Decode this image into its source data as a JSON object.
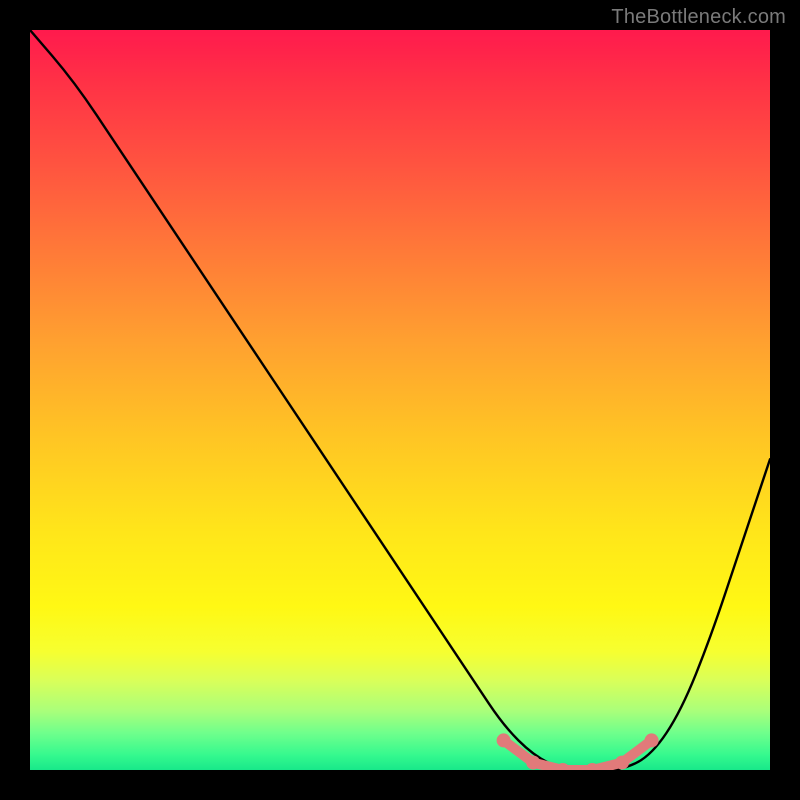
{
  "attribution": "TheBottleneck.com",
  "chart_data": {
    "type": "line",
    "title": "",
    "xlabel": "",
    "ylabel": "",
    "xlim": [
      0,
      100
    ],
    "ylim": [
      0,
      100
    ],
    "x": [
      0,
      6,
      12,
      18,
      24,
      30,
      36,
      42,
      48,
      54,
      60,
      64,
      68,
      72,
      76,
      80,
      84,
      88,
      92,
      96,
      100
    ],
    "y": [
      100,
      93,
      84,
      75,
      66,
      57,
      48,
      39,
      30,
      21,
      12,
      6,
      2,
      0,
      0,
      0,
      2,
      8,
      18,
      30,
      42
    ],
    "series": [
      {
        "name": "bottleneck-curve",
        "x": [
          0,
          6,
          12,
          18,
          24,
          30,
          36,
          42,
          48,
          54,
          60,
          64,
          68,
          72,
          76,
          80,
          84,
          88,
          92,
          96,
          100
        ],
        "y": [
          100,
          93,
          84,
          75,
          66,
          57,
          48,
          39,
          30,
          21,
          12,
          6,
          2,
          0,
          0,
          0,
          2,
          8,
          18,
          30,
          42
        ]
      }
    ],
    "markers": {
      "name": "optimal-range",
      "x": [
        64,
        68,
        72,
        76,
        80,
        84
      ],
      "y": [
        4,
        1,
        0,
        0,
        1,
        4
      ]
    },
    "colors": {
      "curve": "#000000",
      "markers": "#e17a7a",
      "gradient_top": "#ff1a4d",
      "gradient_bottom": "#18e88a",
      "frame": "#000000",
      "attribution_text": "#7a7a7a"
    }
  }
}
